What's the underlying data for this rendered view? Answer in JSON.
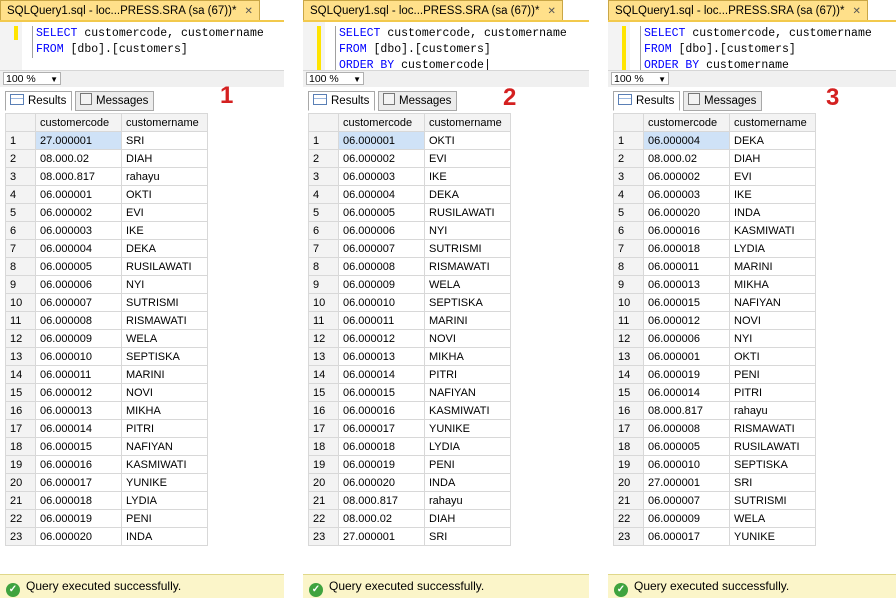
{
  "panels": [
    {
      "tab_title": "SQLQuery1.sql - loc...PRESS.SRA (sa (67))*",
      "sql_lines": [
        "SELECT customercode, customername",
        "FROM [dbo].[customers]"
      ],
      "zoom": "100 %",
      "results_tab": "Results",
      "messages_tab": "Messages",
      "number": "1",
      "columns": [
        "customercode",
        "customername"
      ],
      "rows": [
        [
          "1",
          "27.000001",
          "SRI"
        ],
        [
          "2",
          "08.000.02",
          "DIAH"
        ],
        [
          "3",
          "08.000.817",
          "rahayu"
        ],
        [
          "4",
          "06.000001",
          "OKTI"
        ],
        [
          "5",
          "06.000002",
          "EVI"
        ],
        [
          "6",
          "06.000003",
          "IKE"
        ],
        [
          "7",
          "06.000004",
          "DEKA"
        ],
        [
          "8",
          "06.000005",
          "RUSILAWATI"
        ],
        [
          "9",
          "06.000006",
          "NYI"
        ],
        [
          "10",
          "06.000007",
          "SUTRISMI"
        ],
        [
          "11",
          "06.000008",
          "RISMAWATI"
        ],
        [
          "12",
          "06.000009",
          "WELA"
        ],
        [
          "13",
          "06.000010",
          "SEPTISKA"
        ],
        [
          "14",
          "06.000011",
          "MARINI"
        ],
        [
          "15",
          "06.000012",
          "NOVI"
        ],
        [
          "16",
          "06.000013",
          "MIKHA"
        ],
        [
          "17",
          "06.000014",
          "PITRI"
        ],
        [
          "18",
          "06.000015",
          "NAFIYAN"
        ],
        [
          "19",
          "06.000016",
          "KASMIWATI"
        ],
        [
          "20",
          "06.000017",
          "YUNIKE"
        ],
        [
          "21",
          "06.000018",
          "LYDIA"
        ],
        [
          "22",
          "06.000019",
          "PENI"
        ],
        [
          "23",
          "06.000020",
          "INDA"
        ]
      ],
      "status": "Query executed successfully."
    },
    {
      "tab_title": "SQLQuery1.sql - loc...PRESS.SRA (sa (67))*",
      "sql_lines": [
        "SELECT customercode, customername",
        "FROM [dbo].[customers]",
        "ORDER BY customercode"
      ],
      "zoom": "100 %",
      "results_tab": "Results",
      "messages_tab": "Messages",
      "number": "2",
      "columns": [
        "customercode",
        "customername"
      ],
      "rows": [
        [
          "1",
          "06.000001",
          "OKTI"
        ],
        [
          "2",
          "06.000002",
          "EVI"
        ],
        [
          "3",
          "06.000003",
          "IKE"
        ],
        [
          "4",
          "06.000004",
          "DEKA"
        ],
        [
          "5",
          "06.000005",
          "RUSILAWATI"
        ],
        [
          "6",
          "06.000006",
          "NYI"
        ],
        [
          "7",
          "06.000007",
          "SUTRISMI"
        ],
        [
          "8",
          "06.000008",
          "RISMAWATI"
        ],
        [
          "9",
          "06.000009",
          "WELA"
        ],
        [
          "10",
          "06.000010",
          "SEPTISKA"
        ],
        [
          "11",
          "06.000011",
          "MARINI"
        ],
        [
          "12",
          "06.000012",
          "NOVI"
        ],
        [
          "13",
          "06.000013",
          "MIKHA"
        ],
        [
          "14",
          "06.000014",
          "PITRI"
        ],
        [
          "15",
          "06.000015",
          "NAFIYAN"
        ],
        [
          "16",
          "06.000016",
          "KASMIWATI"
        ],
        [
          "17",
          "06.000017",
          "YUNIKE"
        ],
        [
          "18",
          "06.000018",
          "LYDIA"
        ],
        [
          "19",
          "06.000019",
          "PENI"
        ],
        [
          "20",
          "06.000020",
          "INDA"
        ],
        [
          "21",
          "08.000.817",
          "rahayu"
        ],
        [
          "22",
          "08.000.02",
          "DIAH"
        ],
        [
          "23",
          "27.000001",
          "SRI"
        ]
      ],
      "status": "Query executed successfully."
    },
    {
      "tab_title": "SQLQuery1.sql - loc...PRESS.SRA (sa (67))*",
      "sql_lines": [
        "SELECT customercode, customername",
        "FROM [dbo].[customers]",
        "ORDER BY customername"
      ],
      "zoom": "100 %",
      "results_tab": "Results",
      "messages_tab": "Messages",
      "number": "3",
      "columns": [
        "customercode",
        "customername"
      ],
      "rows": [
        [
          "1",
          "06.000004",
          "DEKA"
        ],
        [
          "2",
          "08.000.02",
          "DIAH"
        ],
        [
          "3",
          "06.000002",
          "EVI"
        ],
        [
          "4",
          "06.000003",
          "IKE"
        ],
        [
          "5",
          "06.000020",
          "INDA"
        ],
        [
          "6",
          "06.000016",
          "KASMIWATI"
        ],
        [
          "7",
          "06.000018",
          "LYDIA"
        ],
        [
          "8",
          "06.000011",
          "MARINI"
        ],
        [
          "9",
          "06.000013",
          "MIKHA"
        ],
        [
          "10",
          "06.000015",
          "NAFIYAN"
        ],
        [
          "11",
          "06.000012",
          "NOVI"
        ],
        [
          "12",
          "06.000006",
          "NYI"
        ],
        [
          "13",
          "06.000001",
          "OKTI"
        ],
        [
          "14",
          "06.000019",
          "PENI"
        ],
        [
          "15",
          "06.000014",
          "PITRI"
        ],
        [
          "16",
          "08.000.817",
          "rahayu"
        ],
        [
          "17",
          "06.000008",
          "RISMAWATI"
        ],
        [
          "18",
          "06.000005",
          "RUSILAWATI"
        ],
        [
          "19",
          "06.000010",
          "SEPTISKA"
        ],
        [
          "20",
          "27.000001",
          "SRI"
        ],
        [
          "21",
          "06.000007",
          "SUTRISMI"
        ],
        [
          "22",
          "06.000009",
          "WELA"
        ],
        [
          "23",
          "06.000017",
          "YUNIKE"
        ]
      ],
      "status": "Query executed successfully."
    }
  ]
}
